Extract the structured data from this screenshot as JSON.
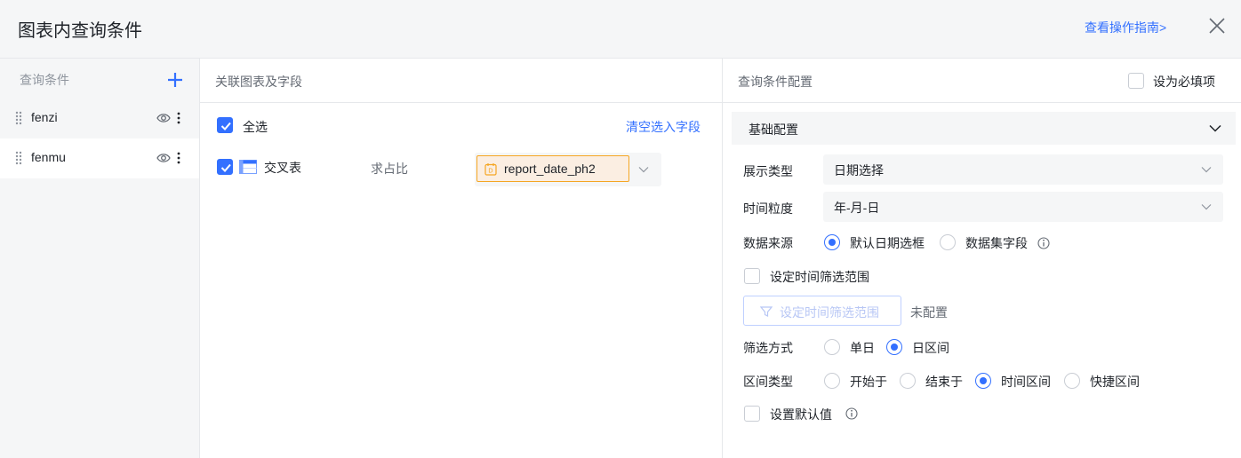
{
  "dialog": {
    "title": "图表内查询条件",
    "guide_link": "查看操作指南>"
  },
  "icons": {
    "close": "close-icon",
    "add": "plus-icon",
    "drag": "drag-handle-icon",
    "eye": "eye-icon",
    "more": "more-vertical-icon",
    "table": "table-icon",
    "date": "date-field-icon",
    "chevron": "chevron-down-icon",
    "info": "info-icon",
    "filter": "funnel-icon"
  },
  "colors": {
    "accent": "#3370ff",
    "tag_border": "#f5a623",
    "tag_bg": "#fbeee2"
  },
  "left": {
    "title": "查询条件",
    "items": [
      {
        "label": "fenzi",
        "active": false
      },
      {
        "label": "fenmu",
        "active": true
      }
    ]
  },
  "middle": {
    "title": "关联图表及字段",
    "select_all": {
      "label": "全选",
      "checked": true
    },
    "clear_link": "清空选入字段",
    "rows": [
      {
        "checked": true,
        "chart": "交叉表",
        "field": "求占比",
        "selected_field": "report_date_ph2"
      }
    ]
  },
  "right": {
    "title": "查询条件配置",
    "required": {
      "label": "设为必填项",
      "checked": false
    },
    "section": "基础配置",
    "display_type": {
      "label": "展示类型",
      "value": "日期选择"
    },
    "granularity": {
      "label": "时间粒度",
      "value": "年-月-日"
    },
    "data_source": {
      "label": "数据来源",
      "options": [
        {
          "label": "默认日期选框",
          "checked": true
        },
        {
          "label": "数据集字段",
          "checked": false
        }
      ]
    },
    "time_range": {
      "label": "设定时间筛选范围",
      "checked": false,
      "button": "设定时间筛选范围",
      "status": "未配置"
    },
    "filter_mode": {
      "label": "筛选方式",
      "options": [
        {
          "label": "单日",
          "checked": false
        },
        {
          "label": "日区间",
          "checked": true
        }
      ]
    },
    "range_type": {
      "label": "区间类型",
      "options": [
        {
          "label": "开始于",
          "checked": false
        },
        {
          "label": "结束于",
          "checked": false
        },
        {
          "label": "时间区间",
          "checked": true
        },
        {
          "label": "快捷区间",
          "checked": false
        }
      ]
    },
    "default_value": {
      "label": "设置默认值",
      "checked": false
    }
  }
}
